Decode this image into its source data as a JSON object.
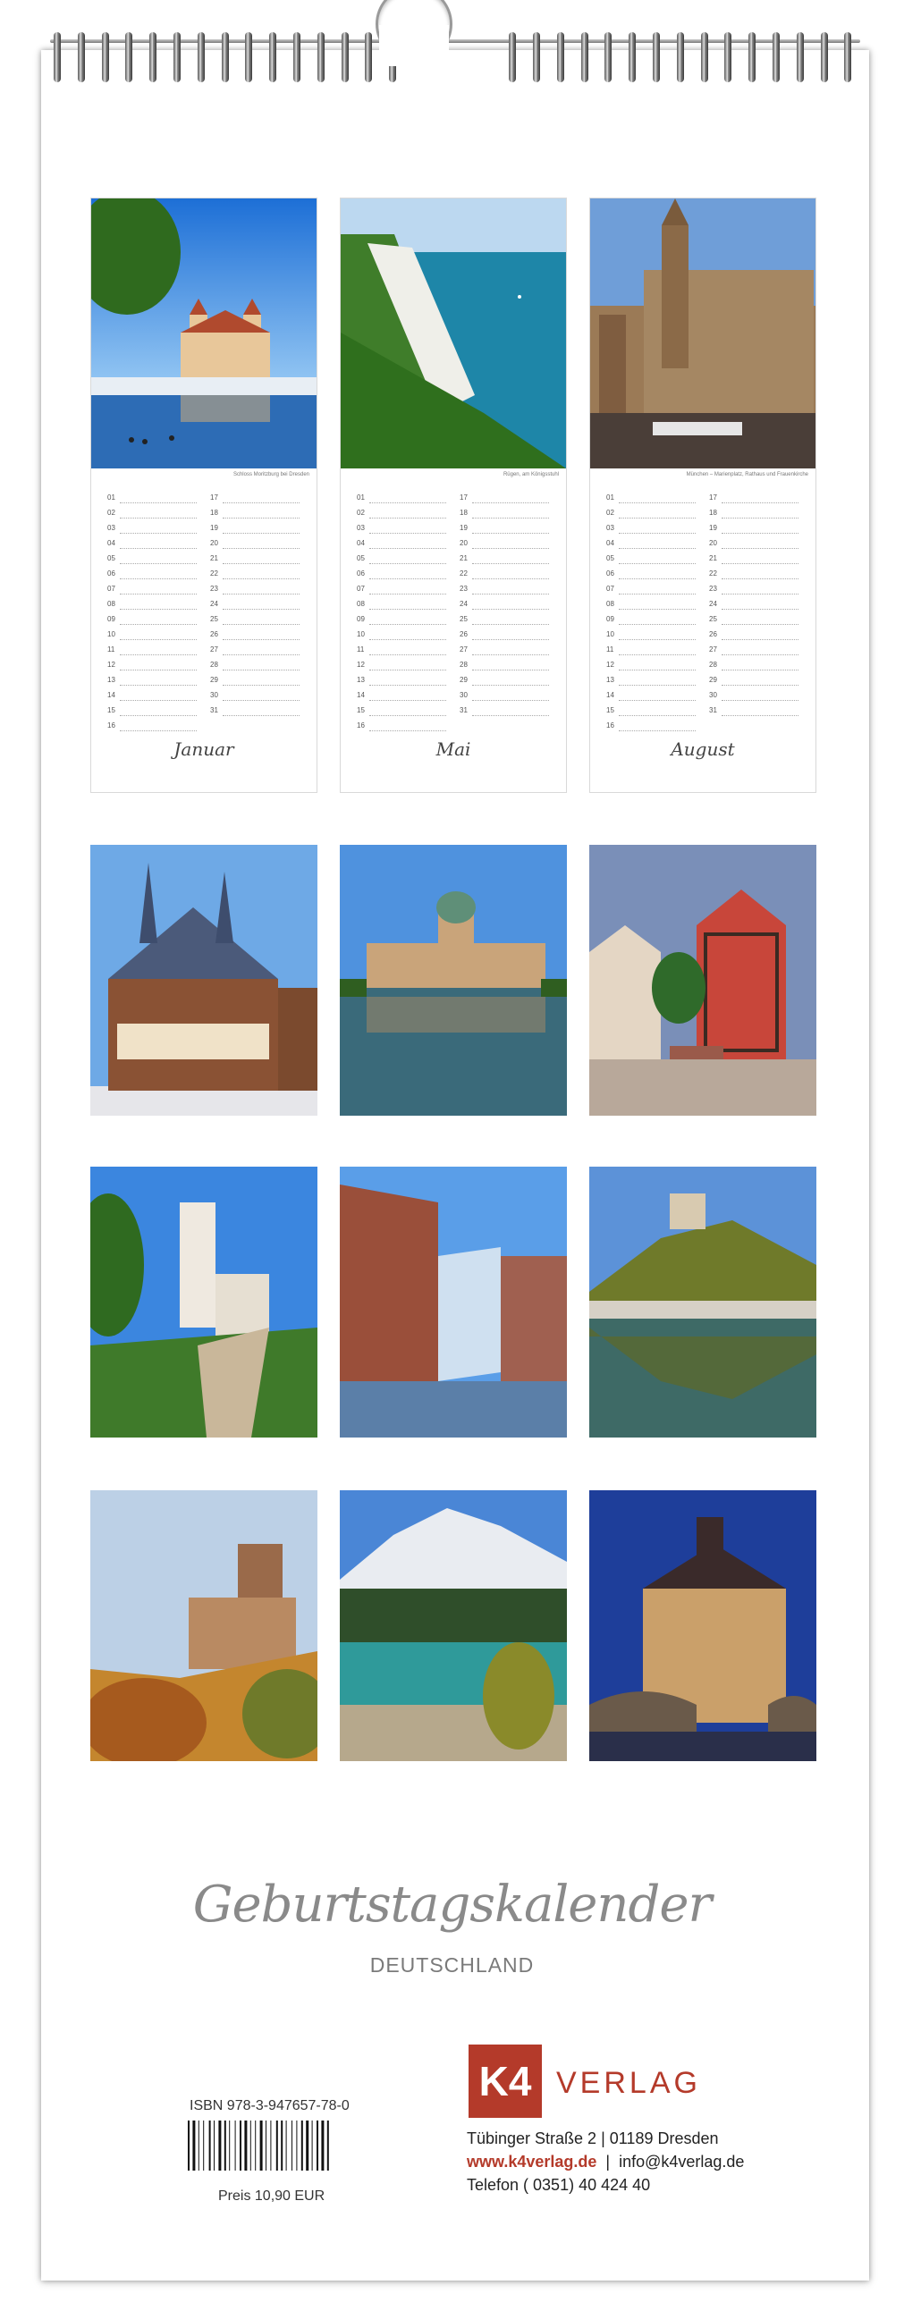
{
  "months": [
    {
      "name": "Januar",
      "caption": "Schloss Moritzburg bei Dresden"
    },
    {
      "name": "Mai",
      "caption": "Rügen, am Königsstuhl"
    },
    {
      "name": "August",
      "caption": "München – Marienplatz, Rathaus und Frauenkirche"
    }
  ],
  "days_left": [
    "01",
    "02",
    "03",
    "04",
    "05",
    "06",
    "07",
    "08",
    "09",
    "10",
    "11",
    "12",
    "13",
    "14",
    "15",
    "16"
  ],
  "days_right": [
    "17",
    "18",
    "19",
    "20",
    "21",
    "22",
    "23",
    "24",
    "25",
    "26",
    "27",
    "28",
    "29",
    "30",
    "31"
  ],
  "title": "Geburtstagskalender",
  "subtitle": "DEUTSCHLAND",
  "isbn": "ISBN 978-3-947657-78-0",
  "price": "Preis 10,90 EUR",
  "publisher": {
    "logo_mark": "K4",
    "logo_text": "VERLAG",
    "address": "Tübinger Straße 2  |  01189 Dresden",
    "web": "www.k4verlag.de",
    "separator": "  |  ",
    "email": "info@k4verlag.de",
    "phone": "Telefon ( 0351) 40 424 40"
  }
}
